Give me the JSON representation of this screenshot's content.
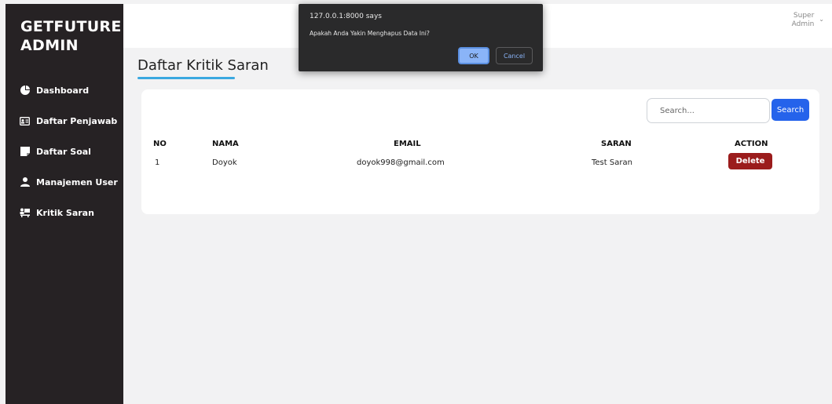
{
  "sidebar": {
    "brand_line1": "GETFUTURE",
    "brand_line2": "ADMIN",
    "items": [
      {
        "label": "Dashboard",
        "icon": "chart-pie-icon"
      },
      {
        "label": "Daftar Penjawab",
        "icon": "id-card-icon"
      },
      {
        "label": "Daftar Soal",
        "icon": "note-icon"
      },
      {
        "label": "Manajemen User",
        "icon": "user-icon"
      },
      {
        "label": "Kritik Saran",
        "icon": "people-table-icon"
      }
    ]
  },
  "header": {
    "user_line1": "Super",
    "user_line2": "Admin",
    "caret": "⌄"
  },
  "main": {
    "title": "Daftar Kritik Saran",
    "search": {
      "placeholder": "Search...",
      "value": "",
      "button_label": "Search"
    },
    "table": {
      "columns": [
        "NO",
        "NAMA",
        "EMAIL",
        "SARAN",
        "ACTION"
      ],
      "rows": [
        {
          "no": "1",
          "nama": "Doyok",
          "email": "doyok998@gmail.com",
          "saran": "Test Saran",
          "action": "Delete"
        }
      ]
    }
  },
  "dialog": {
    "origin": "127.0.0.1:8000 says",
    "message": "Apakah Anda Yakin Menghapus Data Ini?",
    "ok_label": "OK",
    "cancel_label": "Cancel"
  },
  "colors": {
    "sidebar_bg": "#262224",
    "accent_blue": "#2563eb",
    "delete_red": "#9b1c1c",
    "title_underline": "#3aa8e0",
    "dialog_bg": "#2a2a2b"
  }
}
